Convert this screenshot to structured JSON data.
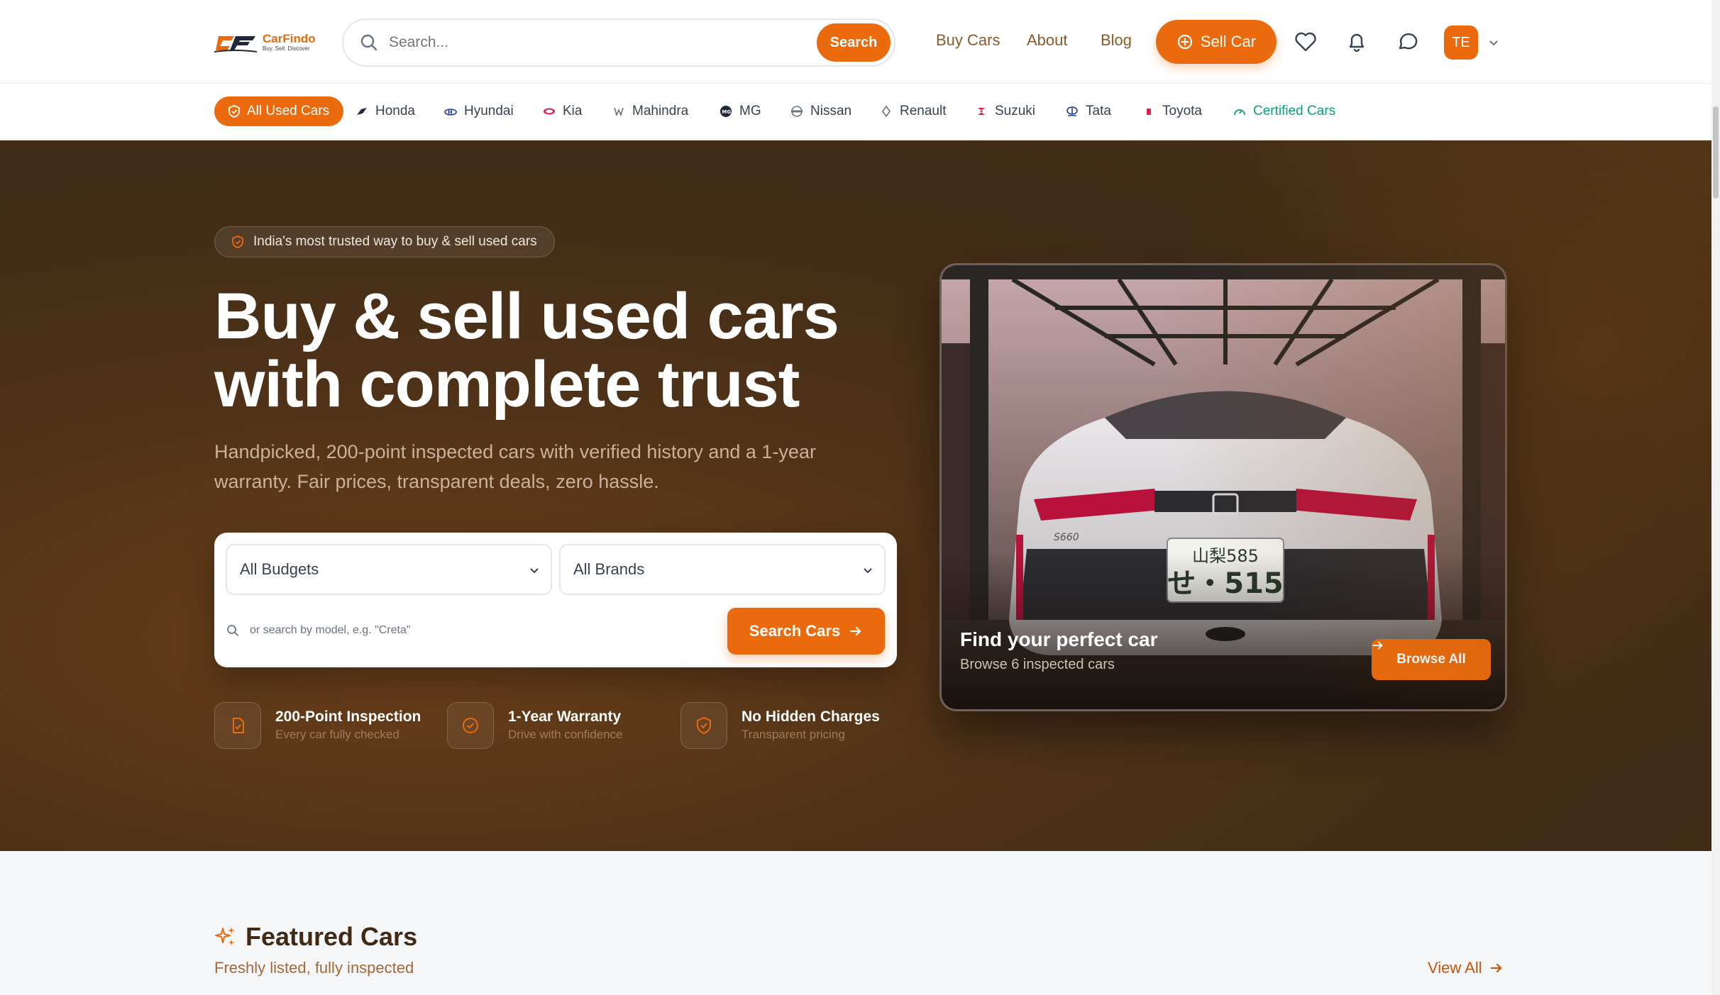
{
  "header": {
    "logo_name": "CarFindo",
    "logo_tag": "Buy. Sell. Discover",
    "search_placeholder": "Search...",
    "search_button": "Search",
    "nav": [
      "Buy Cars",
      "About",
      "Blog"
    ],
    "sell_button": "Sell Car",
    "avatar_initials": "TE",
    "icons": [
      "search-icon",
      "plus-circle-icon",
      "heart-icon",
      "bell-icon",
      "chat-icon",
      "chevron-down-icon"
    ]
  },
  "brands": {
    "all_label": "All Used Cars",
    "items": [
      "Honda",
      "Hyundai",
      "Kia",
      "Mahindra",
      "MG",
      "Nissan",
      "Renault",
      "Suzuki",
      "Tata",
      "Toyota"
    ],
    "certified_label": "Certified Cars"
  },
  "hero": {
    "badge": "India's most trusted way to buy & sell used cars",
    "headline_line1": "Buy & sell used cars",
    "headline_line2": "with complete trust",
    "subcopy": "Handpicked, 200-point inspected cars with verified history and a 1-year warranty. Fair prices, transparent deals, zero hassle.",
    "budget_select": "All Budgets",
    "brand_select": "All Brands",
    "model_placeholder": "or search by model, e.g. \"Creta\"",
    "search_cars_button": "Search Cars",
    "features": [
      {
        "title": "200-Point Inspection",
        "sub": "Every car fully checked"
      },
      {
        "title": "1-Year Warranty",
        "sub": "Drive with confidence"
      },
      {
        "title": "No Hidden Charges",
        "sub": "Transparent pricing"
      }
    ],
    "photo_card": {
      "title": "Find your perfect car",
      "sub": "Browse 6 inspected cars",
      "button": "Browse All",
      "plate_top": "山梨585",
      "plate_bottom": "せ・515",
      "car_badge": "S660"
    }
  },
  "featured": {
    "title": "Featured Cars",
    "sub": "Freshly listed, fully inspected",
    "view_all": "View All"
  },
  "colors": {
    "accent": "#ea6a0d",
    "certified": "#0f9d77",
    "hero_bg": "#4f3218"
  }
}
